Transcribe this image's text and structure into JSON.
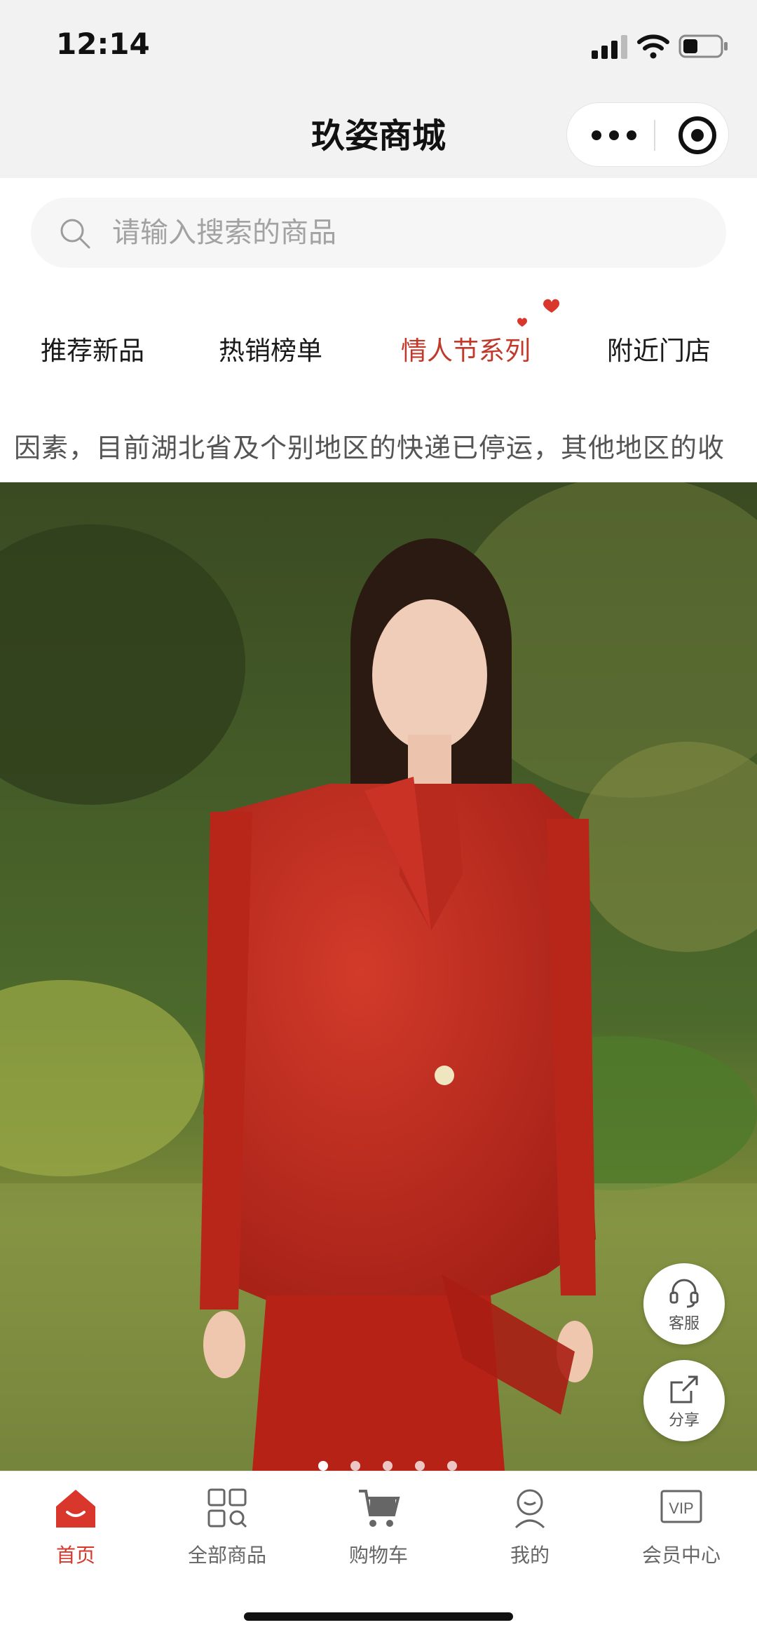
{
  "status_bar": {
    "time": "12:14"
  },
  "nav": {
    "title": "玖姿商城"
  },
  "search": {
    "placeholder": "请输入搜索的商品"
  },
  "tabs": [
    {
      "label": "推荐新品",
      "active": false
    },
    {
      "label": "热销榜单",
      "active": false
    },
    {
      "label": "情人节系列",
      "active": true
    },
    {
      "label": "附近门店",
      "active": false
    }
  ],
  "notice": {
    "text": "因素，目前湖北省及个别地区的快递已停运，其他地区的收"
  },
  "banner": {
    "slide_count": 5,
    "active_slide": 0
  },
  "floating": {
    "service_label": "客服",
    "share_label": "分享"
  },
  "tabbar": [
    {
      "label": "首页",
      "icon": "home-icon",
      "active": true
    },
    {
      "label": "全部商品",
      "icon": "grid-icon",
      "active": false
    },
    {
      "label": "购物车",
      "icon": "cart-icon",
      "active": false
    },
    {
      "label": "我的",
      "icon": "user-icon",
      "active": false
    },
    {
      "label": "会员中心",
      "icon": "vip-icon",
      "active": false
    }
  ],
  "colors": {
    "accent": "#c0392b",
    "tab_active": "#d9362c",
    "header_bg": "#f2f2f2"
  }
}
